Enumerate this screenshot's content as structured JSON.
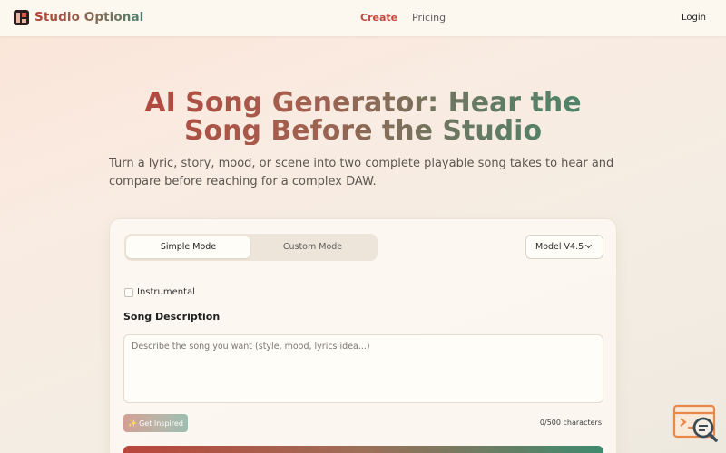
{
  "nav": {
    "brand": "Studio Optional",
    "links": [
      "Create",
      "Pricing"
    ],
    "login": "Login"
  },
  "hero": {
    "title_line1": "AI Song Generator: Hear the",
    "title_line2": "Song Before the Studio",
    "subtitle_line1": "Turn a lyric, story, mood, or scene into two complete playable song takes to hear and",
    "subtitle_line2": "compare before reaching for a complex DAW."
  },
  "form": {
    "modes": [
      "Simple Mode",
      "Custom Mode"
    ],
    "active_mode": "Simple Mode",
    "model": "Model V4.5",
    "instrumental_label": "Instrumental",
    "instrumental_checked": false,
    "description_label": "Song Description",
    "description_placeholder": "Describe the song you want (style, mood, lyrics idea...)",
    "description_value": "",
    "inspire_label": "Get Inspired",
    "char_count": "0/500 characters"
  },
  "colors": {
    "accent_red": "#c4473d",
    "accent_green": "#3f8a6f",
    "corner_widget": "#e8884a"
  },
  "icons": [
    "logo-icon",
    "chevron-down-icon",
    "sparkle-icon",
    "search-code-icon"
  ]
}
